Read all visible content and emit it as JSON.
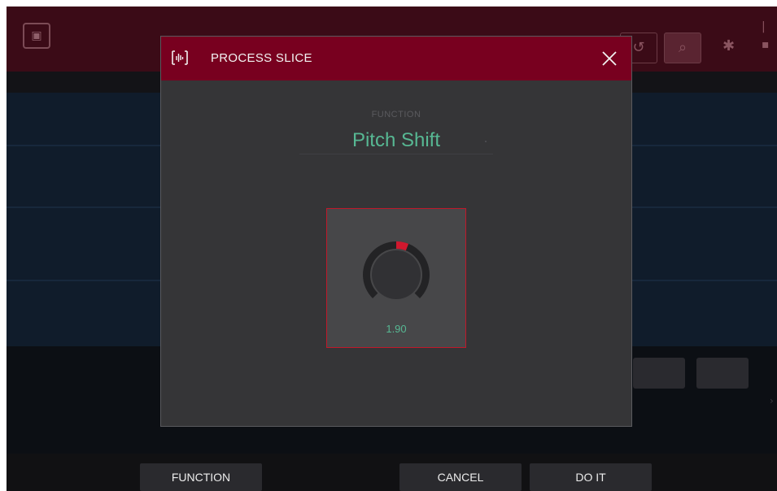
{
  "dialog": {
    "title": "PROCESS SLICE",
    "function_label": "FUNCTION",
    "function_value": "Pitch Shift",
    "knob_value": "1.90",
    "knob_level_fraction": 0.08
  },
  "softkeys": {
    "function": "FUNCTION",
    "cancel": "CANCEL",
    "do_it": "DO IT"
  },
  "colors": {
    "header": "#78001f",
    "accent_text": "#57b893",
    "knob_active": "#d0182e",
    "panel_border": "#c0182a"
  },
  "icons": {
    "dialog_icon": "waveform-slice-icon",
    "close": "close-icon"
  }
}
